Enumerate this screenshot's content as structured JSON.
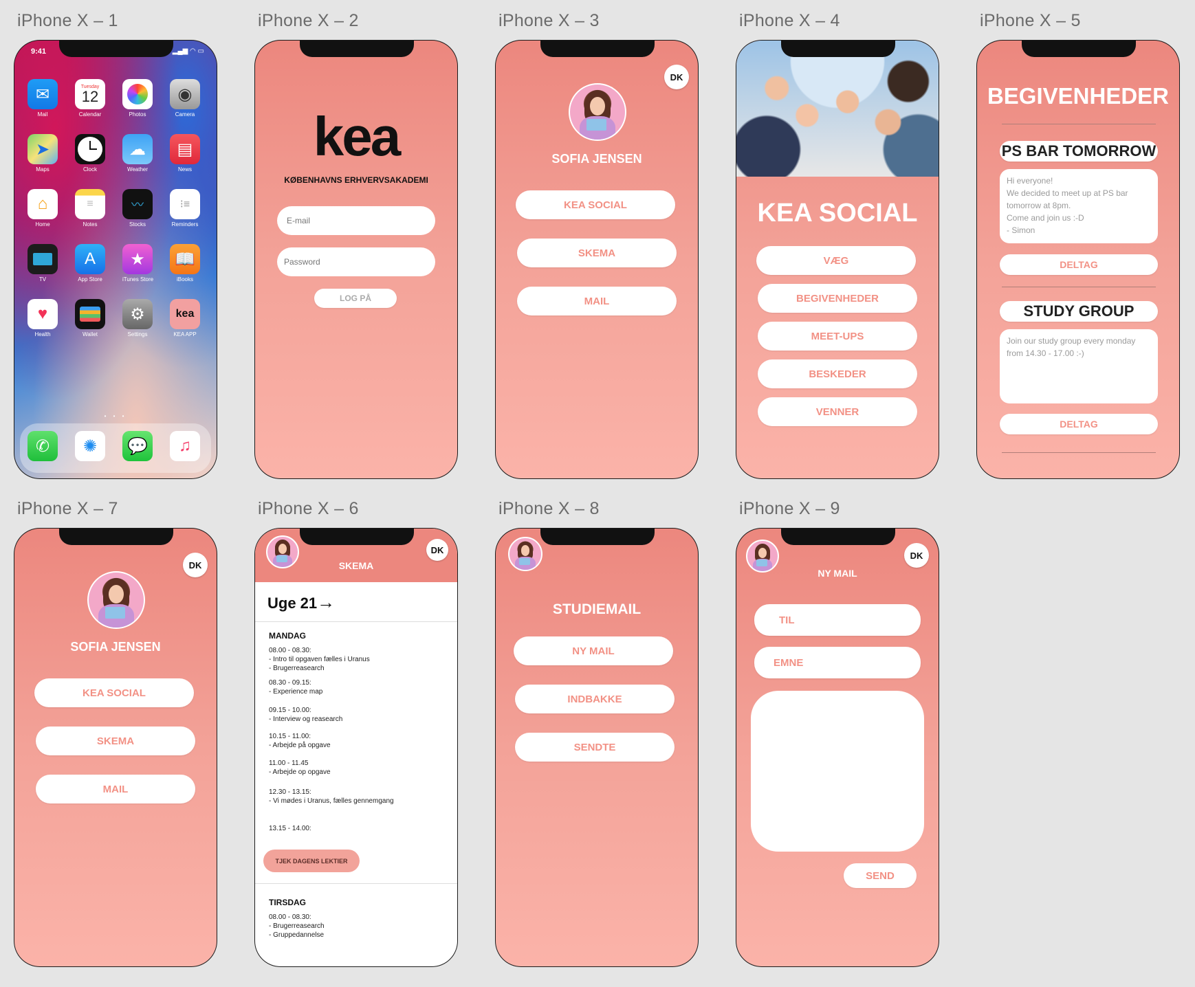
{
  "artboards": {
    "a1": "iPhone X – 1",
    "a2": "iPhone X – 2",
    "a3": "iPhone X – 3",
    "a4": "iPhone X – 4",
    "a5": "iPhone X – 5",
    "a7": "iPhone X – 7",
    "a6": "iPhone X – 6",
    "a8": "iPhone X – 8",
    "a9": "iPhone X – 9"
  },
  "home": {
    "time": "9:41",
    "calendar_day": "Tuesday",
    "calendar_date": "12",
    "apps": [
      "Mail",
      "Calendar",
      "Photos",
      "Camera",
      "Maps",
      "Clock",
      "Weather",
      "News",
      "Home",
      "Notes",
      "Stocks",
      "Reminders",
      "TV",
      "App Store",
      "iTunes Store",
      "iBooks",
      "Health",
      "Wallet",
      "Settings",
      "KEA APP"
    ],
    "kea_icon_text": "kea"
  },
  "login": {
    "logo": "kea",
    "subtitle": "KØBENHAVNS ERHVERVSAKADEMI",
    "email_placeholder": "E-mail",
    "password_placeholder": "Password",
    "login_button": "LOG PÅ"
  },
  "profile": {
    "lang": "DK",
    "name": "SOFIA JENSEN",
    "buttons": [
      "KEA SOCIAL",
      "SKEMA",
      "MAIL"
    ]
  },
  "social": {
    "title": "KEA SOCIAL",
    "buttons": [
      "VÆG",
      "BEGIVENHEDER",
      "MEET-UPS",
      "BESKEDER",
      "VENNER"
    ]
  },
  "events": {
    "title": "BEGIVENHEDER",
    "items": [
      {
        "title": "PS BAR TOMORROW",
        "text": "Hi everyone!\nWe decided to meet up at PS bar\ntomorrow at 8pm.\nCome and join us :-D\n- Simon",
        "button": "DELTAG"
      },
      {
        "title": "STUDY GROUP",
        "text": "Join our study group every monday\nfrom 14.30 - 17.00 :-)",
        "button": "DELTAG"
      }
    ]
  },
  "schedule": {
    "lang": "DK",
    "title": "SKEMA",
    "week": "Uge 21",
    "arrow": "→",
    "monday": "MANDAG",
    "entries": [
      "08.00 - 08.30:\n - Intro til opgaven fælles i Uranus\n - Brugerreasearch",
      "08.30 - 09.15:\n - Experience map",
      "09.15 - 10.00:\n - Interview og reasearch",
      "10.15 - 11.00:\n - Arbejde på opgave",
      "11.00 - 11.45\n - Arbejde op opgave",
      "12.30 - 13.15:\n - Vi mødes i Uranus, fælles gennemgang",
      "13.15 - 14.00:"
    ],
    "check_button": "TJEK DAGENS LEKTIER",
    "tuesday": "TIRSDAG",
    "tuesday_entries": "08.00 - 08.30:\n - Brugerreasearch\n - Gruppedannelse"
  },
  "studymail": {
    "title": "STUDIEMAIL",
    "buttons": [
      "NY MAIL",
      "INDBAKKE",
      "SENDTE"
    ]
  },
  "newmail": {
    "lang": "DK",
    "title": "NY MAIL",
    "to": "TIL",
    "subject": "EMNE",
    "send": "SEND"
  },
  "colors": {
    "coral_top": "#ec877e",
    "coral_bottom": "#fbb3a9",
    "accent_text": "#f29185"
  }
}
